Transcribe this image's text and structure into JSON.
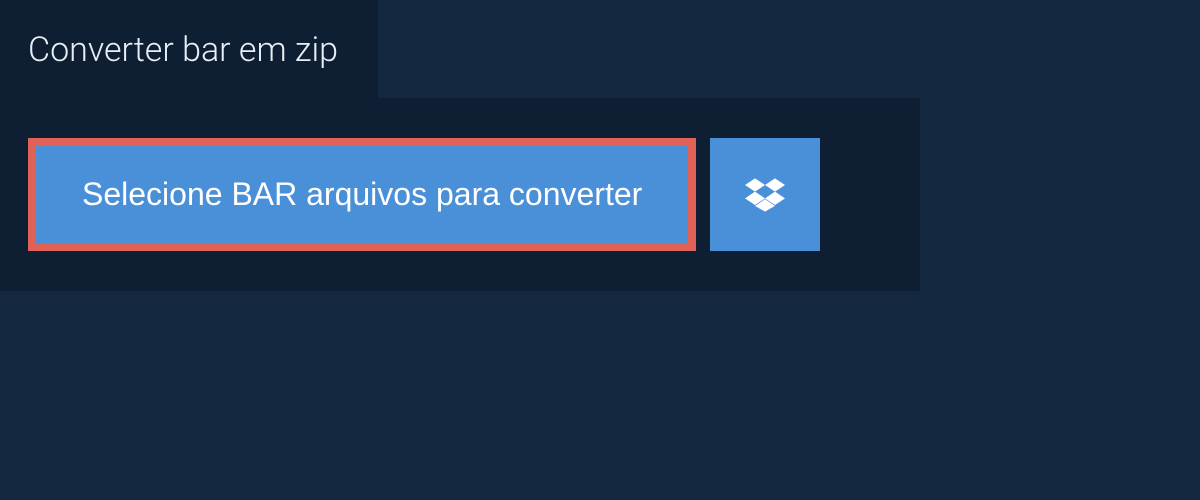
{
  "tab": {
    "label": "Converter bar em zip"
  },
  "actions": {
    "select_files_label": "Selecione BAR arquivos para converter"
  }
}
